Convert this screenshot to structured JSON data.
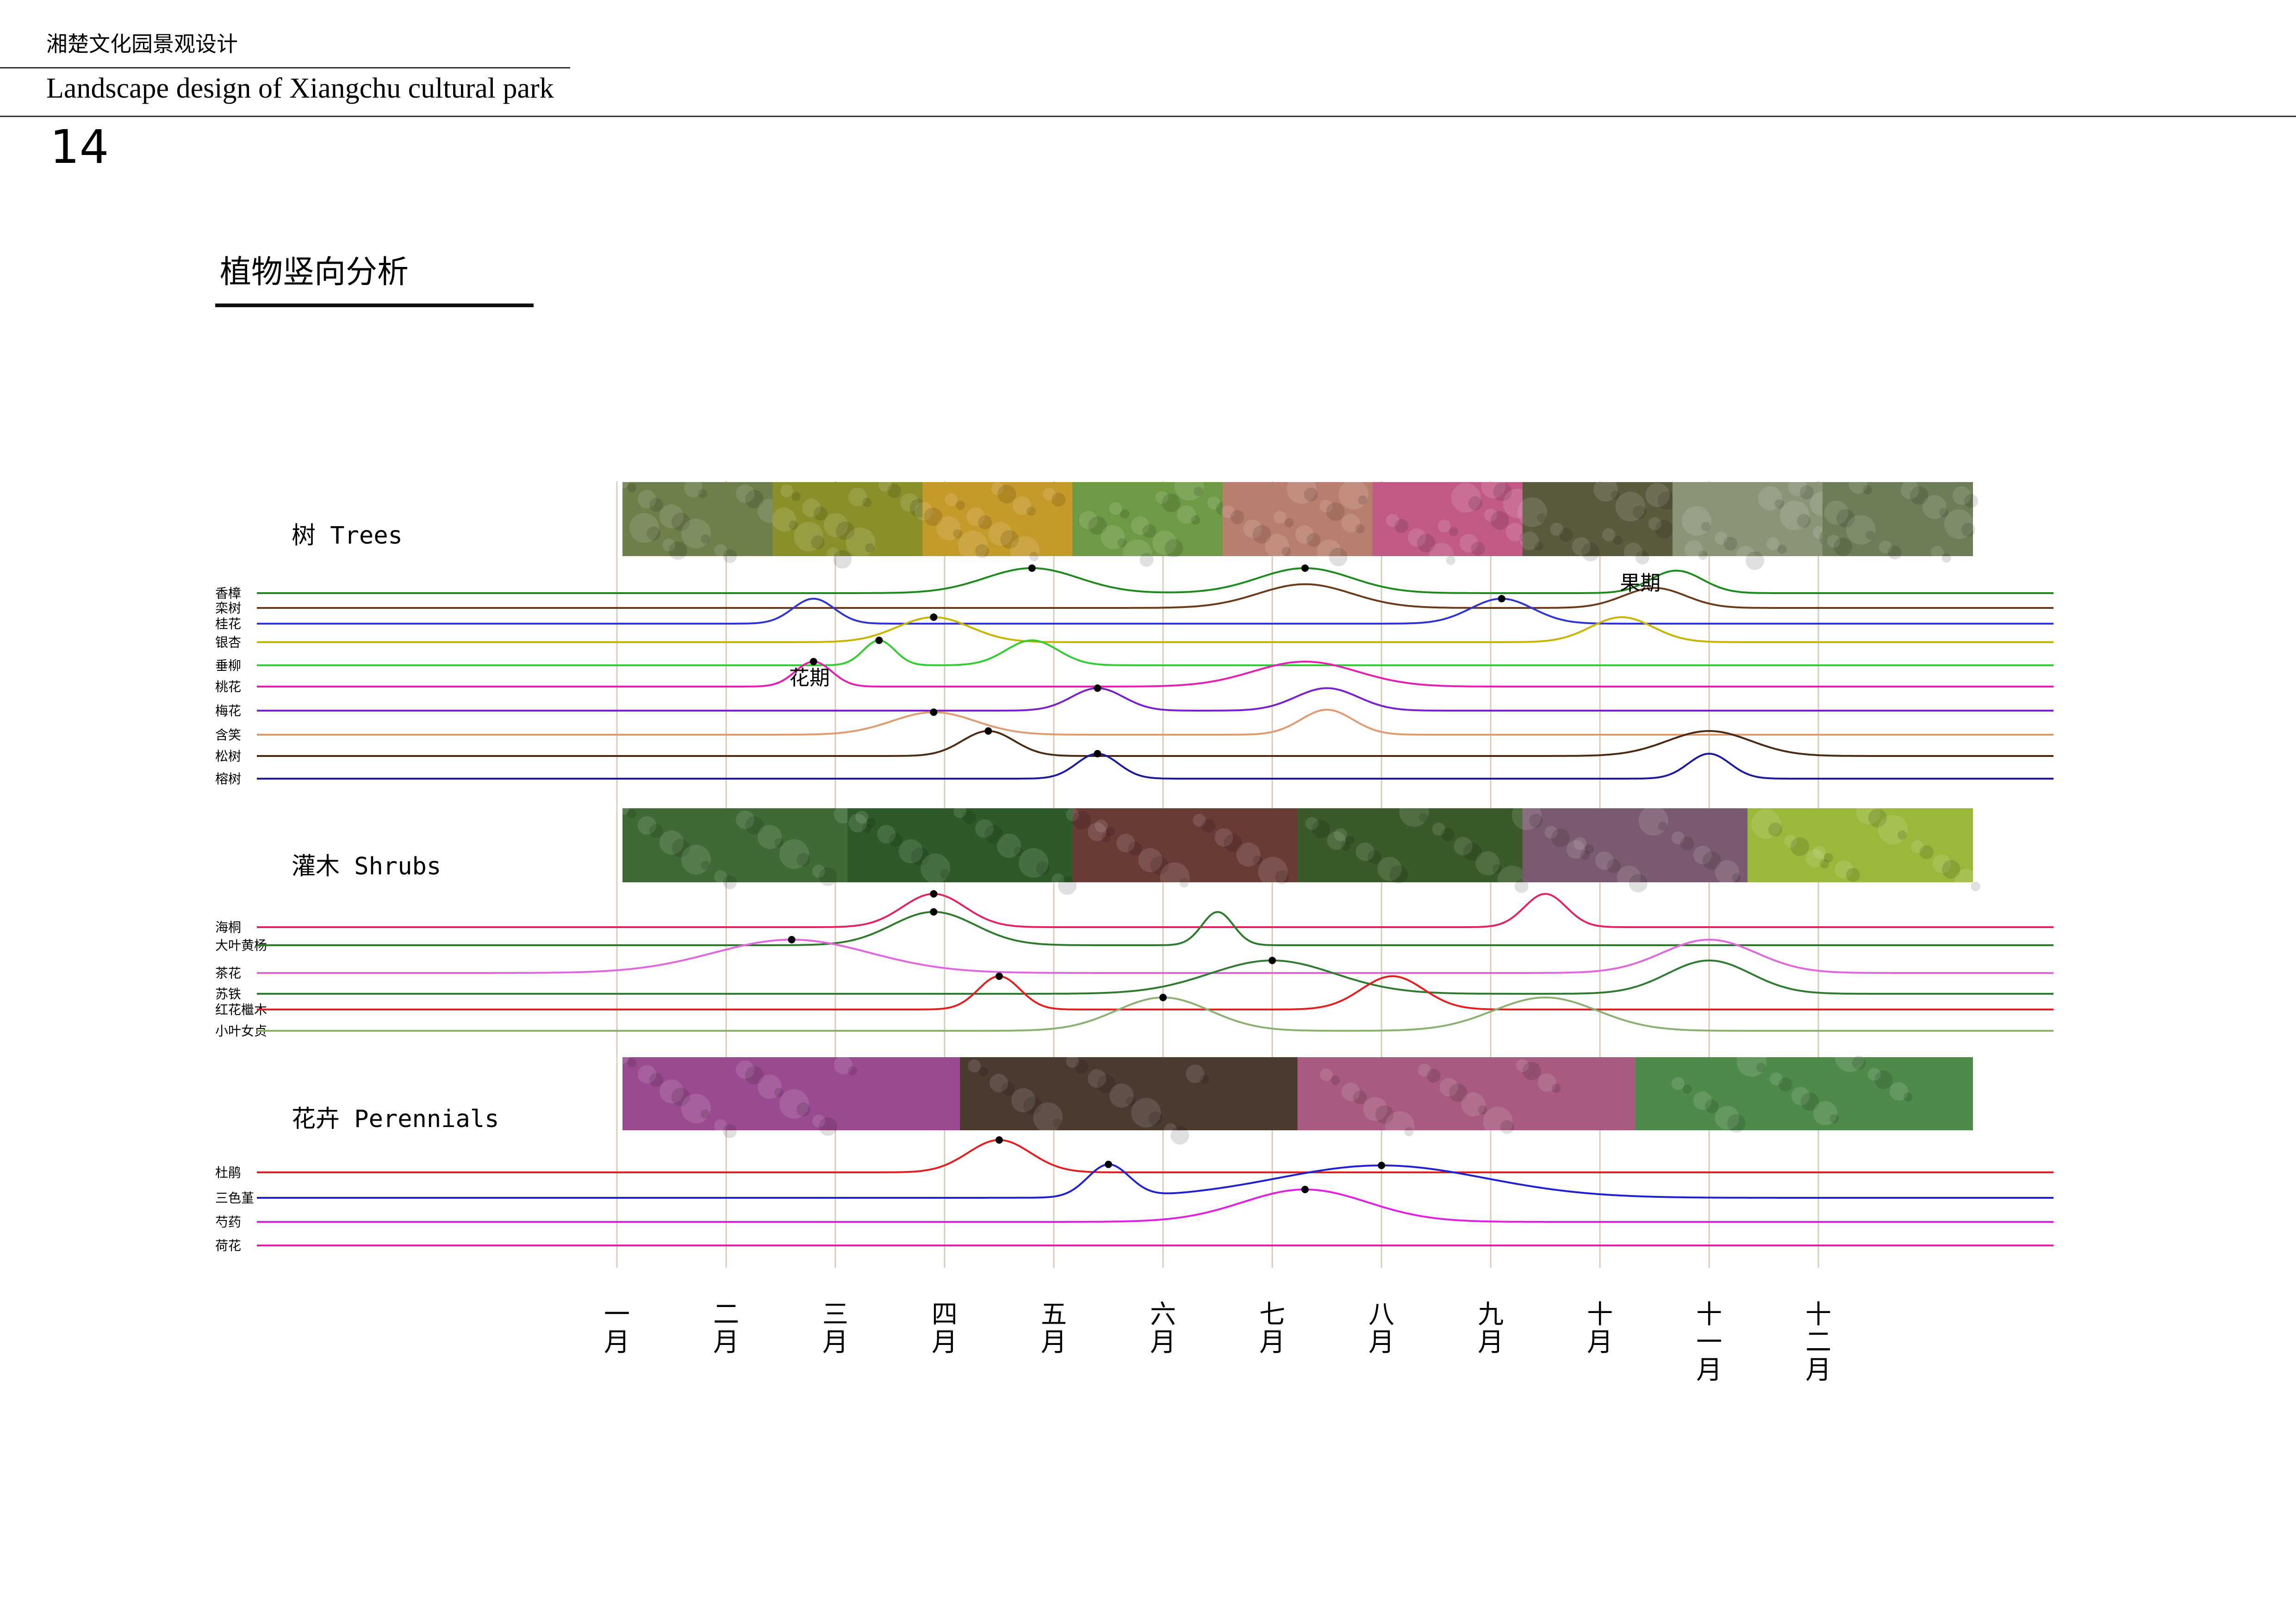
{
  "header": {
    "title_cn": "湘楚文化园景观设计",
    "title_en": "Landscape design of Xiangchu cultural park",
    "page_number": "14"
  },
  "section": {
    "title": "植物竖向分析"
  },
  "chart_data": {
    "type": "line",
    "x": [
      "一月",
      "二月",
      "三月",
      "四月",
      "五月",
      "六月",
      "七月",
      "八月",
      "九月",
      "十月",
      "十一月",
      "十二月"
    ],
    "x_labels_stacked": [
      [
        "一",
        "月"
      ],
      [
        "二",
        "月"
      ],
      [
        "三",
        "月"
      ],
      [
        "四",
        "月"
      ],
      [
        "五",
        "月"
      ],
      [
        "六",
        "月"
      ],
      [
        "七",
        "月"
      ],
      [
        "八",
        "月"
      ],
      [
        "九",
        "月"
      ],
      [
        "十",
        "月"
      ],
      [
        "十",
        "一",
        "月"
      ],
      [
        "十",
        "二",
        "月"
      ]
    ],
    "annotations": [
      {
        "text": "花期",
        "group": "Trees"
      },
      {
        "text": "果期",
        "group": "Trees"
      }
    ],
    "groups": [
      {
        "name": "树 Trees",
        "photos": [
          {
            "color": "#6e7f4a",
            "icon": "leaf-photo"
          },
          {
            "color": "#8a8f2a",
            "icon": "osmanthus-photo"
          },
          {
            "color": "#c49a2a",
            "icon": "ginkgo-photo"
          },
          {
            "color": "#6f9a45",
            "icon": "willow-photo"
          },
          {
            "color": "#b97f6e",
            "icon": "peach-blossom-photo"
          },
          {
            "color": "#c25a86",
            "icon": "plum-blossom-photo"
          },
          {
            "color": "#5c5a3e",
            "icon": "magnolia-photo"
          },
          {
            "color": "#8a9578",
            "icon": "pine-photo"
          },
          {
            "color": "#6d7d58",
            "icon": "banyan-photo"
          }
        ],
        "series": [
          {
            "name": "香樟",
            "color": "#1e8a1e",
            "peaks": [
              {
                "month": 3.8,
                "h": 1.0,
                "w": 0.9,
                "dot": true
              },
              {
                "month": 6.3,
                "h": 1.0,
                "w": 0.9,
                "dot": true
              },
              {
                "month": 9.7,
                "h": 0.9,
                "w": 0.5
              }
            ]
          },
          {
            "name": "栾树",
            "color": "#6b3a1a",
            "peaks": [
              {
                "month": 6.3,
                "h": 0.95,
                "w": 0.9
              },
              {
                "month": 9.5,
                "h": 0.8,
                "w": 0.6
              }
            ]
          },
          {
            "name": "桂花",
            "color": "#2f34cc",
            "peaks": [
              {
                "month": 1.8,
                "h": 1.0,
                "w": 0.4
              },
              {
                "month": 8.1,
                "h": 1.0,
                "w": 0.6,
                "dot": true
              }
            ]
          },
          {
            "name": "银杏",
            "color": "#c8b400",
            "peaks": [
              {
                "month": 2.9,
                "h": 1.0,
                "w": 0.7,
                "dot": true
              },
              {
                "month": 9.2,
                "h": 1.0,
                "w": 0.6
              }
            ]
          },
          {
            "name": "垂柳",
            "color": "#33cc33",
            "peaks": [
              {
                "month": 2.4,
                "h": 1.0,
                "w": 0.3,
                "dot": true
              },
              {
                "month": 3.8,
                "h": 1.0,
                "w": 0.5
              }
            ]
          },
          {
            "name": "桃花",
            "color": "#e020b0",
            "peaks": [
              {
                "month": 1.8,
                "h": 1.0,
                "w": 0.35,
                "dot": true
              },
              {
                "month": 6.3,
                "h": 1.0,
                "w": 1.0
              }
            ]
          },
          {
            "name": "梅花",
            "color": "#7a20c8",
            "peaks": [
              {
                "month": 4.4,
                "h": 0.9,
                "w": 0.5,
                "dot": true
              },
              {
                "month": 6.5,
                "h": 0.9,
                "w": 0.6
              }
            ]
          },
          {
            "name": "含笑",
            "color": "#e09a70",
            "peaks": [
              {
                "month": 2.9,
                "h": 0.9,
                "w": 0.8,
                "dot": true
              },
              {
                "month": 6.5,
                "h": 1.0,
                "w": 0.5
              }
            ]
          },
          {
            "name": "松树",
            "color": "#4a2a12",
            "peaks": [
              {
                "month": 3.4,
                "h": 1.0,
                "w": 0.5,
                "dot": true
              },
              {
                "month": 10.0,
                "h": 1.0,
                "w": 0.8
              }
            ]
          },
          {
            "name": "榕树",
            "color": "#1a1a9a",
            "peaks": [
              {
                "month": 4.4,
                "h": 1.0,
                "w": 0.4,
                "dot": true
              },
              {
                "month": 10.0,
                "h": 1.0,
                "w": 0.4
              }
            ]
          }
        ]
      },
      {
        "name": "灌木 Shrubs",
        "photos": [
          {
            "color": "#3f6a35",
            "icon": "pittosporum-photo"
          },
          {
            "color": "#2e5a2a",
            "icon": "boxwood-photo"
          },
          {
            "color": "#6a3a36",
            "icon": "camellia-photo"
          },
          {
            "color": "#3a5a2a",
            "icon": "cycad-photo"
          },
          {
            "color": "#7a5a70",
            "icon": "loropetalum-photo"
          },
          {
            "color": "#9ab83a",
            "icon": "privet-photo"
          }
        ],
        "series": [
          {
            "name": "海桐",
            "color": "#e0245e",
            "peaks": [
              {
                "month": 2.9,
                "h": 1.0,
                "w": 0.6,
                "dot": true
              },
              {
                "month": 8.5,
                "h": 1.0,
                "w": 0.4
              }
            ]
          },
          {
            "name": "大叶黄杨",
            "color": "#2a7a2a",
            "peaks": [
              {
                "month": 2.9,
                "h": 1.0,
                "w": 0.8,
                "dot": true
              },
              {
                "month": 5.5,
                "h": 1.0,
                "w": 0.3
              }
            ]
          },
          {
            "name": "茶花",
            "color": "#e066dd",
            "peaks": [
              {
                "month": 1.6,
                "h": 1.0,
                "w": 1.5,
                "dot": true
              },
              {
                "month": 10.0,
                "h": 1.0,
                "w": 0.9
              }
            ]
          },
          {
            "name": "苏铁",
            "color": "#2e7a2e",
            "peaks": [
              {
                "month": 6.0,
                "h": 1.0,
                "w": 1.2,
                "dot": true
              },
              {
                "month": 10.0,
                "h": 1.0,
                "w": 0.8
              }
            ]
          },
          {
            "name": "红花檵木",
            "color": "#e02020",
            "peaks": [
              {
                "month": 3.5,
                "h": 1.0,
                "w": 0.4,
                "dot": true
              },
              {
                "month": 7.1,
                "h": 1.0,
                "w": 0.6
              }
            ]
          },
          {
            "name": "小叶女贞",
            "color": "#8ab070",
            "peaks": [
              {
                "month": 5.0,
                "h": 1.0,
                "w": 0.9,
                "dot": true
              },
              {
                "month": 8.5,
                "h": 1.0,
                "w": 1.0
              }
            ]
          }
        ]
      },
      {
        "name": "花卉 Perennials",
        "photos": [
          {
            "color": "#9a4a90",
            "icon": "azalea-photo"
          },
          {
            "color": "#4a3a30",
            "icon": "pansy-photo"
          },
          {
            "color": "#a85a80",
            "icon": "peony-photo"
          },
          {
            "color": "#4e8a4a",
            "icon": "lotus-photo"
          }
        ],
        "series": [
          {
            "name": "杜鹃",
            "color": "#e02020",
            "peaks": [
              {
                "month": 3.5,
                "h": 1.0,
                "w": 0.6,
                "dot": true
              }
            ]
          },
          {
            "name": "三色堇",
            "color": "#2020cc",
            "peaks": [
              {
                "month": 4.5,
                "h": 1.0,
                "w": 0.4,
                "dot": true
              },
              {
                "month": 7.0,
                "h": 1.0,
                "w": 2.0,
                "dot": true
              }
            ]
          },
          {
            "name": "芍药",
            "color": "#e020e0",
            "peaks": [
              {
                "month": 6.3,
                "h": 1.0,
                "w": 1.2,
                "dot": true
              }
            ]
          },
          {
            "name": "荷花",
            "color": "#e020a0",
            "peaks": []
          }
        ]
      }
    ]
  }
}
